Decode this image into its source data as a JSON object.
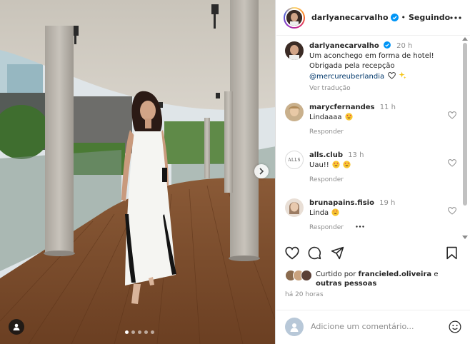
{
  "post": {
    "author": "darlyanecarvalho",
    "follow_status": "Seguindo",
    "separator": "•",
    "caption": {
      "time": "20 h",
      "text": "Um aconchego em forma de hotel! Obrigada pela recepção",
      "mention": "@mercureuberlandia",
      "translate": "Ver tradução"
    },
    "carousel": {
      "total": 5,
      "active_index": 0
    }
  },
  "comments": [
    {
      "user": "marycfernandes",
      "time": "11 h",
      "text": "Lindaaaa",
      "emoji_count": 1,
      "reply": "Responder"
    },
    {
      "user": "alls.club",
      "time": "13 h",
      "text": "Uau!!",
      "emoji_count": 2,
      "reply": "Responder",
      "avatar_text": "ALLS"
    },
    {
      "user": "brunapains.fisio",
      "time": "19 h",
      "text": "Linda",
      "emoji_count": 1,
      "reply": "Responder"
    }
  ],
  "likes": {
    "prefix": "Curtido por",
    "user": "francieled.oliveira",
    "suffix": "e",
    "others": "outras pessoas"
  },
  "posted_ago": "há 20 horas",
  "add_comment": {
    "placeholder": "Adicione um comentário..."
  },
  "colors": {
    "verified": "#0095f6",
    "mention": "#00376b",
    "muted": "#8e8e8e",
    "text": "#262626"
  },
  "icons": [
    "more-options-icon",
    "heart-icon",
    "comment-icon",
    "share-icon",
    "bookmark-icon",
    "emoji-icon",
    "next-arrow-icon",
    "user-tag-icon",
    "verified-badge-icon"
  ]
}
